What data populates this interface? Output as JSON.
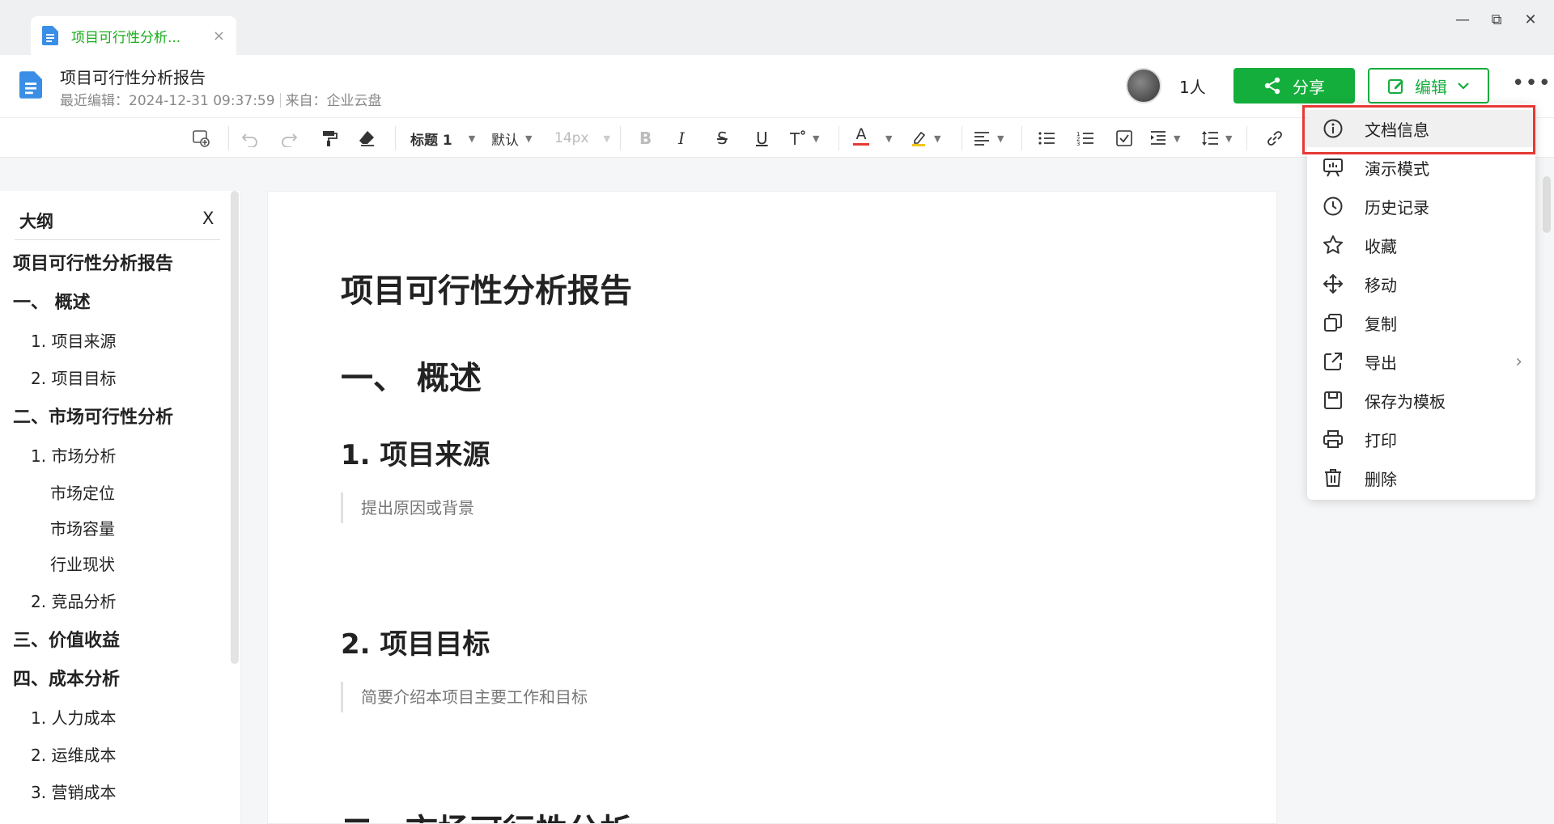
{
  "tab": {
    "title": "项目可行性分析...",
    "close": "×"
  },
  "window_controls": {
    "minimize": "—",
    "restore": "⧉",
    "close": "✕"
  },
  "header": {
    "doc_title": "项目可行性分析报告",
    "last_edit": "最近编辑：2024-12-31 09:37:59",
    "source": "来自：企业云盘",
    "people_count": "1人",
    "share_label": "分享",
    "edit_label": "编辑",
    "more": "•••"
  },
  "toolbar": {
    "heading": "标题 1",
    "font": "默认",
    "size": "14px",
    "bold": "B",
    "italic": "I",
    "strike": "S",
    "underline": "U",
    "text_color": "A"
  },
  "outline": {
    "title": "大纲",
    "close": "X",
    "items": [
      {
        "label": "项目可行性分析报告",
        "level": 1
      },
      {
        "label": "一、 概述",
        "level": 1
      },
      {
        "label": "1. 项目来源",
        "level": 2
      },
      {
        "label": "2. 项目目标",
        "level": 2
      },
      {
        "label": "二、市场可行性分析",
        "level": 1
      },
      {
        "label": "1. 市场分析",
        "level": 2
      },
      {
        "label": "市场定位",
        "level": 3
      },
      {
        "label": "市场容量",
        "level": 3
      },
      {
        "label": "行业现状",
        "level": 3
      },
      {
        "label": "2. 竞品分析",
        "level": 2
      },
      {
        "label": "三、价值收益",
        "level": 1
      },
      {
        "label": "四、成本分析",
        "level": 1
      },
      {
        "label": "1. 人力成本",
        "level": 2
      },
      {
        "label": "2. 运维成本",
        "level": 2
      },
      {
        "label": "3. 营销成本",
        "level": 2
      }
    ]
  },
  "document": {
    "title": "项目可行性分析报告",
    "section1": "一、  概述",
    "sub1": "1. 项目来源",
    "sub1_text": "提出原因或背景",
    "sub2": "2. 项目目标",
    "sub2_text": "简要介绍本项目主要工作和目标",
    "section2": "二、市场可行性分析"
  },
  "menu": {
    "items": [
      {
        "label": "文档信息",
        "icon": "info-icon",
        "selected": true
      },
      {
        "label": "演示模式",
        "icon": "presentation-icon"
      },
      {
        "label": "历史记录",
        "icon": "clock-icon"
      },
      {
        "label": "收藏",
        "icon": "star-icon"
      },
      {
        "label": "移动",
        "icon": "move-icon"
      },
      {
        "label": "复制",
        "icon": "copy-icon"
      },
      {
        "label": "导出",
        "icon": "export-icon",
        "submenu": true
      },
      {
        "label": "保存为模板",
        "icon": "save-icon"
      },
      {
        "label": "打印",
        "icon": "print-icon"
      },
      {
        "label": "删除",
        "icon": "trash-icon"
      }
    ]
  },
  "colors": {
    "brand_green": "#14ae3c",
    "tab_green": "#1aad19",
    "highlight_red": "#e53935",
    "doc_blue": "#3a8ee6"
  }
}
